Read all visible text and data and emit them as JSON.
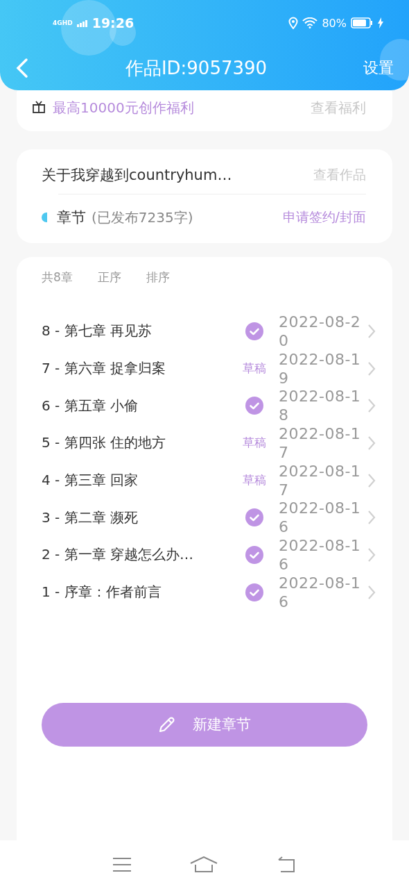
{
  "status_bar": {
    "network": "4GHD",
    "time": "19:26",
    "battery": "80%"
  },
  "header": {
    "title": "作品ID:9057390",
    "action": "设置"
  },
  "welfare": {
    "text": "最高10000元创作福利",
    "link": "查看福利"
  },
  "work": {
    "title": "关于我穿越到countryhum…",
    "link": "查看作品",
    "section": "章节",
    "published": "(已发布7235字)",
    "apply": "申请签约/封面"
  },
  "chapters": {
    "count": "共8章",
    "order": "正序",
    "sort": "排序",
    "items": [
      {
        "title": "8 - 第七章 再见苏",
        "kind": "published",
        "date": "2022-08-20"
      },
      {
        "title": "7 - 第六章 捉拿归案",
        "kind": "draft",
        "status": "草稿",
        "date": "2022-08-19"
      },
      {
        "title": "6 - 第五章 小偷",
        "kind": "published",
        "date": "2022-08-18"
      },
      {
        "title": "5 - 第四张 住的地方",
        "kind": "draft",
        "status": "草稿",
        "date": "2022-08-17"
      },
      {
        "title": "4 - 第三章  回家",
        "kind": "draft",
        "status": "草稿",
        "date": "2022-08-17"
      },
      {
        "title": "3 - 第二章 濒死",
        "kind": "published",
        "date": "2022-08-16"
      },
      {
        "title": "2 - 第一章  穿越怎么办…",
        "kind": "published",
        "date": "2022-08-16"
      },
      {
        "title": "1 - 序章：作者前言",
        "kind": "published",
        "date": "2022-08-16"
      }
    ]
  },
  "new_chapter": "新建章节"
}
